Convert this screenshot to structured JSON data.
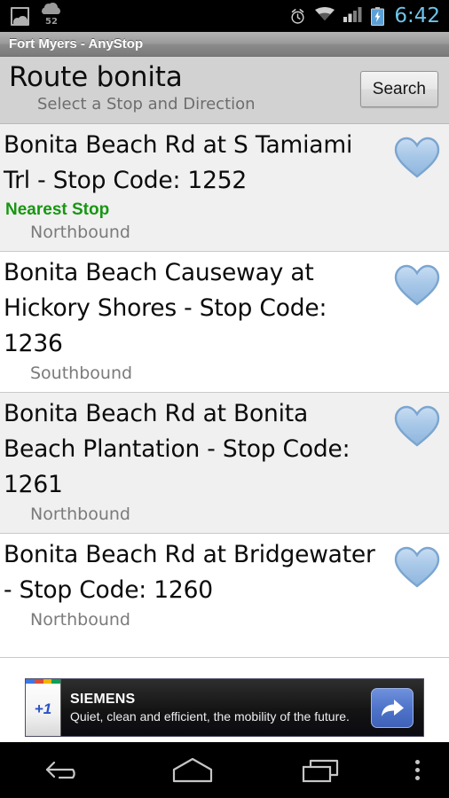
{
  "status_bar": {
    "left_icons": [
      "screenshot-icon",
      "weather-cloud-icon"
    ],
    "weather_temp": "52",
    "right_icons": [
      "alarm-icon",
      "wifi-icon",
      "signal-icon",
      "battery-charging-icon"
    ],
    "time": "6:42",
    "time_color": "#6fc3e8"
  },
  "app_title": "Fort Myers - AnyStop",
  "header": {
    "title": "Route bonita",
    "subtitle": "Select a Stop and Direction",
    "search_label": "Search"
  },
  "stops": [
    {
      "name": "Bonita Beach Rd at S Tamiami Trl - Stop Code: 1252",
      "badge": "Nearest Stop",
      "direction": "Northbound",
      "favorite_icon": "heart-icon"
    },
    {
      "name": "Bonita Beach Causeway at Hickory Shores - Stop Code: 1236",
      "badge": "",
      "direction": "Southbound",
      "favorite_icon": "heart-icon"
    },
    {
      "name": "Bonita Beach Rd at Bonita Beach Plantation - Stop Code: 1261",
      "badge": "",
      "direction": "Northbound",
      "favorite_icon": "heart-icon"
    },
    {
      "name": "Bonita Beach Rd at Bridgewater - Stop Code: 1260",
      "badge": "",
      "direction": "Northbound",
      "favorite_icon": "heart-icon"
    }
  ],
  "ad": {
    "plusone_label": "+1",
    "headline": "SIEMENS",
    "body": "Quiet, clean and efficient, the mobility of the future.",
    "action_icon": "share-arrow-icon"
  },
  "nav_bar": {
    "back": "back-icon",
    "home": "home-icon",
    "recents": "recents-icon",
    "menu": "overflow-menu-icon"
  },
  "colors": {
    "badge_green": "#189612",
    "heart_blue": "#a9cdee",
    "accent_blue": "#4f74c9",
    "row_alt_bg": "#f0f0f0"
  }
}
